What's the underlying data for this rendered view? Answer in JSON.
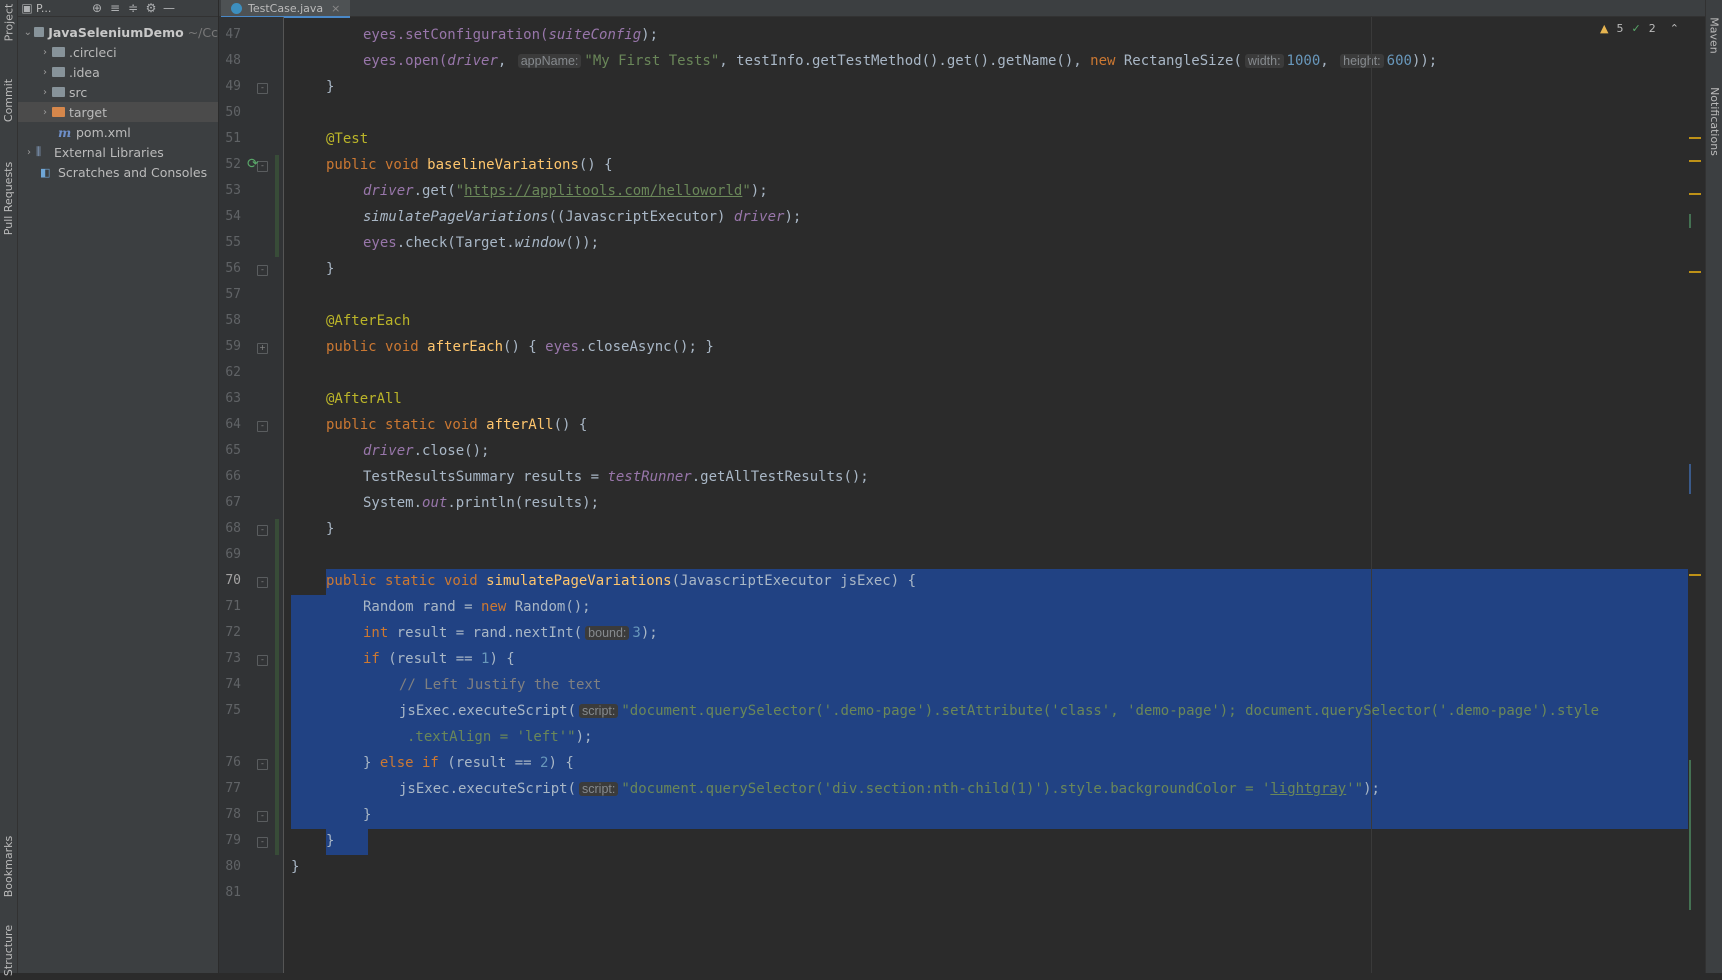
{
  "toolwindow_strip_left": {
    "top_tabs": [
      "Project",
      "Commit",
      "Pull Requests"
    ],
    "bottom_tabs": [
      "Bookmarks",
      "Structure"
    ]
  },
  "toolwindow_strip_right": {
    "tabs": [
      "Maven",
      "Notifications"
    ]
  },
  "project_panel": {
    "title": "P...",
    "tree": [
      {
        "label": "JavaSeleniumDemo",
        "suffix": "~/Cc",
        "expanded": true
      },
      {
        "label": ".circleci"
      },
      {
        "label": ".idea"
      },
      {
        "label": "src"
      },
      {
        "label": "target"
      },
      {
        "label": "pom.xml",
        "icon": "m"
      },
      {
        "label": "External Libraries"
      },
      {
        "label": "Scratches and Consoles"
      }
    ]
  },
  "editor_tab": {
    "label": "TestCase.java"
  },
  "inspections": {
    "warnings": "5",
    "ok": "2"
  },
  "line_numbers": [
    "47",
    "48",
    "49",
    "50",
    "51",
    "52",
    "53",
    "54",
    "55",
    "56",
    "57",
    "58",
    "59",
    "62",
    "63",
    "64",
    "65",
    "66",
    "67",
    "68",
    "69",
    "70",
    "71",
    "72",
    "73",
    "74",
    "75",
    "",
    "76",
    "77",
    "78",
    "79",
    "80",
    "81"
  ],
  "hints": {
    "app_name": "appName:",
    "width": "width:",
    "height": "height:",
    "bound": "bound:",
    "script": "script:"
  },
  "code": {
    "l47_a": "eyes.setConfiguration(",
    "l47_b": "suiteConfig",
    "l47_c": ");",
    "l48_a": "eyes.open(",
    "l48_b": "driver",
    "l48_c": ", ",
    "l48_str": "\"My First Tests\"",
    "l48_d": ", testInfo.getTestMethod().get().getName(), ",
    "l48_new": "new",
    "l48_e": " RectangleSize(",
    "l48_w": "1000",
    "l48_f": ", ",
    "l48_h": "600",
    "l48_g": "));",
    "l49": "}",
    "l51": "@Test",
    "l52_kw": "public void ",
    "l52_fn": "baselineVariations",
    "l52_b": "() {",
    "l53_a": "driver",
    "l53_b": ".get(",
    "l53_q1": "\"",
    "l53_url": "https://applitools.com/helloworld",
    "l53_q2": "\"",
    "l53_c": ");",
    "l54_a": "simulatePageVariations",
    "l54_b": "((JavascriptExecutor) ",
    "l54_c": "driver",
    "l54_d": ");",
    "l55_a": "eyes",
    "l55_b": ".check(Target.",
    "l55_c": "window",
    "l55_d": "());",
    "l56": "}",
    "l58": "@AfterEach",
    "l59_kw": "public void ",
    "l59_fn": "afterEach",
    "l59_b": "() { ",
    "l59_c": "eyes",
    "l59_d": ".closeAsync(); }",
    "l63": "@AfterAll",
    "l64_kw": "public static void ",
    "l64_fn": "afterAll",
    "l64_b": "() {",
    "l65_a": "driver",
    "l65_b": ".close();",
    "l66_a": "TestResultsSummary results = ",
    "l66_b": "testRunner",
    "l66_c": ".getAllTestResults();",
    "l67_a": "System.",
    "l67_b": "out",
    "l67_c": ".println(results);",
    "l68": "}",
    "l70_kw": "public static void ",
    "l70_fn": "simulatePageVariations",
    "l70_b": "(JavascriptExecutor jsExec) {",
    "l71_a": "Random rand = ",
    "l71_new": "new",
    "l71_b": " Random();",
    "l72_kw": "int",
    "l72_a": " result = rand.nextInt(",
    "l72_n": "3",
    "l72_b": ");",
    "l73_kw": "if",
    "l73_a": " (result == ",
    "l73_n": "1",
    "l73_b": ") {",
    "l74": "// Left Justify the text",
    "l75_a": "jsExec.executeScript(",
    "l75_str": "\"document.querySelector('.demo-page').setAttribute('class', 'demo-page'); document.querySelector('.demo-page').style",
    "l75_cont": ".textAlign = 'left'\"",
    "l75_end": ");",
    "l76_a": "} ",
    "l76_kw": "else if",
    "l76_b": " (result == ",
    "l76_n": "2",
    "l76_c": ") {",
    "l77_a": "jsExec.executeScript(",
    "l77_str": "\"document.querySelector('div.section:nth-child(1)').style.backgroundColor = '",
    "l77_u": "lightgray",
    "l77_str2": "'\"",
    "l77_end": ");",
    "l78": "}",
    "l79": "}",
    "l80": "}"
  },
  "colors": {
    "background": "#2b2b2b",
    "selection": "#214283",
    "keyword": "#cc7832",
    "annotation": "#bbb529",
    "method": "#ffc66d",
    "string": "#6a8759",
    "number": "#6897bb"
  }
}
